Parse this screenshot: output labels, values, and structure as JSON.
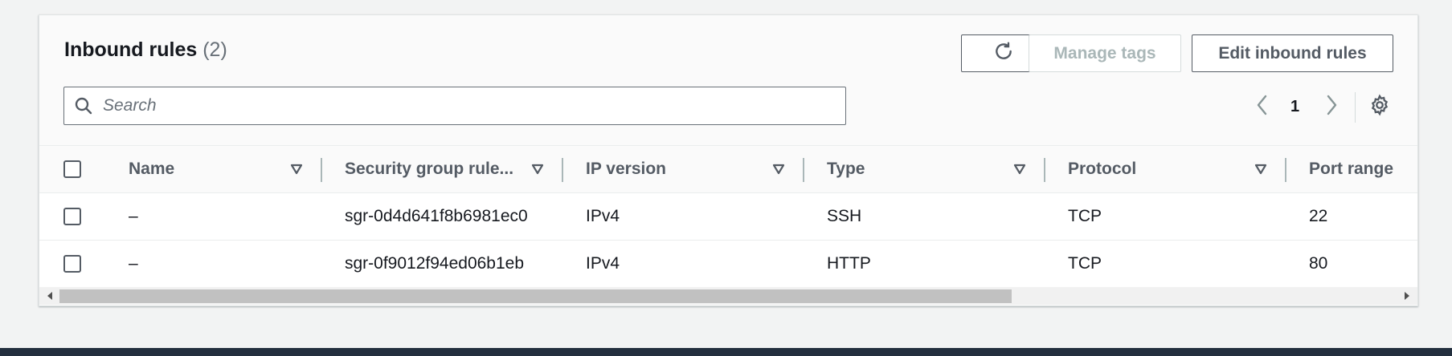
{
  "header": {
    "title": "Inbound rules",
    "count": "(2)",
    "manage_tags_label": "Manage tags",
    "edit_rules_label": "Edit inbound rules"
  },
  "search": {
    "placeholder": "Search",
    "value": ""
  },
  "pagination": {
    "current_page": "1"
  },
  "table": {
    "columns": [
      "Name",
      "Security group rule...",
      "IP version",
      "Type",
      "Protocol",
      "Port range"
    ],
    "rows": [
      {
        "name": "–",
        "rule_id": "sgr-0d4d641f8b6981ec0",
        "ip_version": "IPv4",
        "type": "SSH",
        "protocol": "TCP",
        "port_range": "22"
      },
      {
        "name": "–",
        "rule_id": "sgr-0f9012f94ed06b1eb",
        "ip_version": "IPv4",
        "type": "HTTP",
        "protocol": "TCP",
        "port_range": "80"
      }
    ]
  },
  "icons": {
    "refresh": "refresh-icon",
    "search": "search-icon",
    "prev": "chevron-left-icon",
    "next": "chevron-right-icon",
    "settings": "gear-icon",
    "sort": "sort-down-icon"
  },
  "colors": {
    "footer": "#232f3e",
    "border": "#545b64",
    "disabled": "#aab7b8"
  }
}
